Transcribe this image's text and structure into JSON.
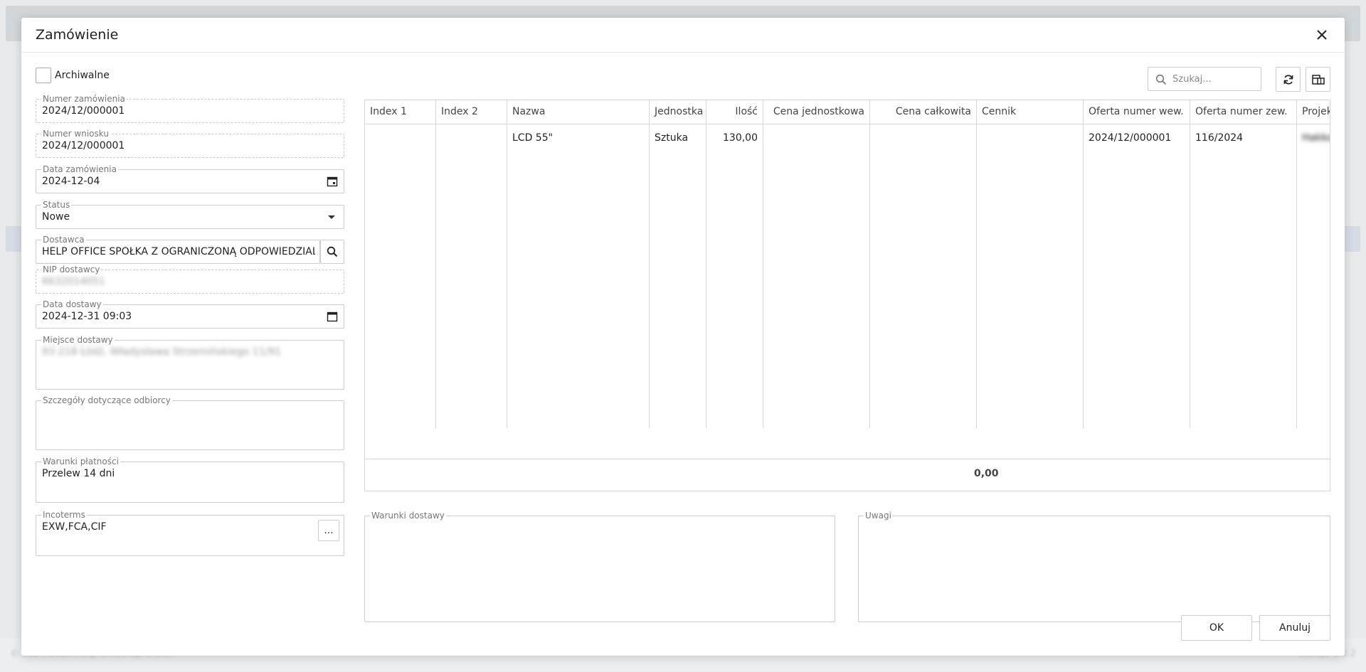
{
  "background": {
    "footer_left": "© 2024-2025 Help Office Sp. z o.o.",
    "footer_right": "Wersja 1.0.2"
  },
  "dialog": {
    "title": "Zamówienie",
    "archive_label": "Archiwalne"
  },
  "form": {
    "order_number": {
      "label": "Numer zamówienia",
      "value": "2024/12/000001"
    },
    "request_number": {
      "label": "Numer wniosku",
      "value": "2024/12/000001"
    },
    "order_date": {
      "label": "Data zamówienia",
      "value": "2024-12-04"
    },
    "status": {
      "label": "Status",
      "value": "Nowe"
    },
    "supplier": {
      "label": "Dostawca",
      "value": "HELP OFFICE SPÓŁKA Z OGRANICZONĄ ODPOWIEDZIALNOŚCIĄ"
    },
    "supplier_nip": {
      "label": "NIP dostawcy",
      "value": "6632014051"
    },
    "delivery_date": {
      "label": "Data dostawy",
      "value": "2024-12-31 09:03"
    },
    "delivery_place": {
      "label": "Miejsce dostawy",
      "value": "93-218 Łódź, Władysława Strzemińskiego 11/91"
    },
    "recipient_details": {
      "label": "Szczegóły dotyczące odbiorcy",
      "value": ""
    },
    "payment_terms": {
      "label": "Warunki płatności",
      "value": "Przelew 14 dni"
    },
    "incoterms": {
      "label": "Incoterms",
      "value": "EXW,FCA,CIF",
      "button": "..."
    }
  },
  "toolbar": {
    "search_placeholder": "Szukaj...",
    "refresh_icon": "refresh-icon",
    "columns_icon": "column-chooser-icon"
  },
  "grid": {
    "headers": [
      "Index 1",
      "Index 2",
      "Nazwa",
      "Jednostka",
      "Ilość",
      "Cena jednostkowa",
      "Cena całkowita",
      "Cennik",
      "Oferta numer wew.",
      "Oferta numer zew.",
      "Projekt"
    ],
    "rows": [
      [
        "",
        "",
        "LCD 55\"",
        "Sztuka",
        "130,00",
        "",
        "",
        "",
        "2024/12/000001",
        "116/2024",
        "Hakko"
      ]
    ],
    "total": "0,00"
  },
  "bottom": {
    "delivery_terms_label": "Warunki dostawy",
    "notes_label": "Uwagi"
  },
  "buttons": {
    "ok": "OK",
    "cancel": "Anuluj"
  }
}
